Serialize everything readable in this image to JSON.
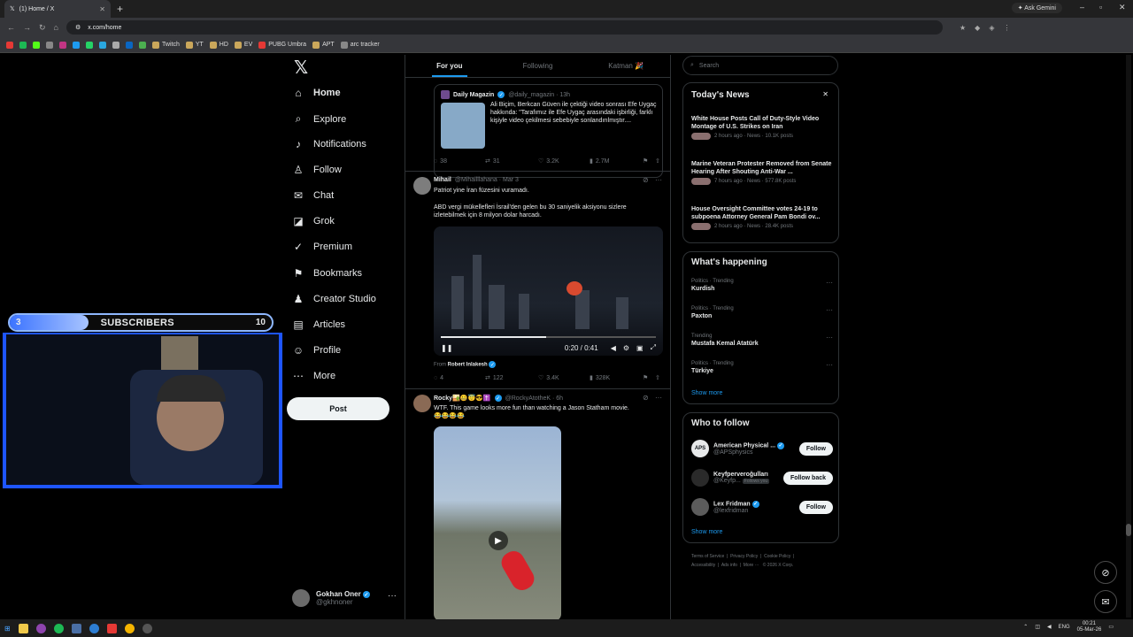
{
  "browser": {
    "tab_title": "(1) Home / X",
    "tab_close": "✕",
    "new_tab": "+",
    "gemini": "Ask Gemini",
    "url": "x.com/home",
    "bookmarks": [
      {
        "label": "Twitch",
        "color": "#caa75b"
      },
      {
        "label": "YT",
        "color": "#caa75b"
      },
      {
        "label": "HD",
        "color": "#caa75b"
      },
      {
        "label": "EV",
        "color": "#caa75b"
      },
      {
        "label": "PUBG Umbra",
        "color": "#e53935"
      },
      {
        "label": "APT",
        "color": "#caa75b"
      },
      {
        "label": "arc tracker",
        "color": "#888888"
      }
    ]
  },
  "nav": {
    "logo": "𝕏",
    "items": [
      {
        "label": "Home",
        "icon": "⌂"
      },
      {
        "label": "Explore",
        "icon": "⌕"
      },
      {
        "label": "Notifications",
        "icon": "♪"
      },
      {
        "label": "Follow",
        "icon": "♙"
      },
      {
        "label": "Chat",
        "icon": "✉"
      },
      {
        "label": "Grok",
        "icon": "◪"
      },
      {
        "label": "Premium",
        "icon": "✓"
      },
      {
        "label": "Bookmarks",
        "icon": "⚑"
      },
      {
        "label": "Creator Studio",
        "icon": "♟"
      },
      {
        "label": "Articles",
        "icon": "▤"
      },
      {
        "label": "Profile",
        "icon": "☺"
      },
      {
        "label": "More",
        "icon": "⋯"
      }
    ],
    "post_label": "Post",
    "account": {
      "name": "Gokhan Oner",
      "handle": "@gkhnoner",
      "more": "···"
    }
  },
  "overlay": {
    "current": "3",
    "title": "SUBSCRIBERS",
    "goal": "10",
    "progress": 0.3
  },
  "feed": {
    "tabs": [
      "For you",
      "Following",
      "Katman 🎉"
    ],
    "quote": {
      "name": "Daily Magazin",
      "meta": "@daily_magazin · 13h",
      "text": "Ali Biçim, Berkcan Güven ile çektiği video sonrası Efe Uygaç hakkında: \"Tarafımız ile Efe Uygaç arasındaki işbirliği, farklı kişiyle video çekilmesi sebebiyle sonlandırılmıştır...."
    },
    "actions1": {
      "replies": "38",
      "reposts": "31",
      "likes": "3.2K",
      "views": "2.7M"
    },
    "tweet2": {
      "name": "Mihail",
      "meta": "@Mihailllahana · Mar 3",
      "line1": "Patriot yine İran füzesini vuramadı.",
      "line2": "ABD vergi mükellefleri İsrail'den gelen bu 30 saniyelik aksiyonu sizlere izletebilmek için 8 milyon dolar harcadı.",
      "video_time": "0:20 / 0:41",
      "video_progress": 0.49,
      "from_label": "From",
      "from_name": "Robert Inlakesh"
    },
    "actions2": {
      "replies": "4",
      "reposts": "122",
      "likes": "3.4K",
      "views": "328K"
    },
    "tweet3": {
      "name": "Rocky🏜️🤐😇😎✝️",
      "meta": "@RockyAtotheK · 6h",
      "text": "WTF. This game looks more fun than watching a Jason Statham movie.",
      "emoji": "😂😂😂😂"
    }
  },
  "right": {
    "search_placeholder": "Search",
    "news_title": "Today's News",
    "news_close": "✕",
    "news": [
      {
        "headline": "White House Posts Call of Duty-Style Video Montage of U.S. Strikes on Iran",
        "meta": "2 hours ago · News · 10.1K posts"
      },
      {
        "headline": "Marine Veteran Protester Removed from Senate Hearing After Shouting Anti-War ...",
        "meta": "7 hours ago · News · 577.8K posts"
      },
      {
        "headline": "House Oversight Committee votes 24-19 to subpoena Attorney General Pam Bondi ov...",
        "meta": "2 hours ago · News · 28.4K posts"
      }
    ],
    "happening_title": "What's happening",
    "trends": [
      {
        "context": "Politics · Trending",
        "topic": "Kurdish"
      },
      {
        "context": "Politics · Trending",
        "topic": "Paxton"
      },
      {
        "context": "Trending",
        "topic": "Mustafa Kemal Atatürk"
      },
      {
        "context": "Politics · Trending",
        "topic": "Türkiye"
      }
    ],
    "show_more": "Show more",
    "wtf_title": "Who to follow",
    "follow": [
      {
        "name": "American Physical ...",
        "handle": "@APSphysics",
        "button": "Follow",
        "avatar": "APS"
      },
      {
        "name": "Keyfperveroğulları",
        "handle": "@Keyfp...",
        "badge": "Follows you",
        "button": "Follow back",
        "avatar": ""
      },
      {
        "name": "Lex Fridman",
        "handle": "@lexfridman",
        "button": "Follow",
        "avatar": ""
      }
    ],
    "footer": [
      "Terms of Service",
      "Privacy Policy",
      "Cookie Policy",
      "Accessibility",
      "Ads info",
      "More ···",
      "© 2026 X Corp."
    ]
  },
  "taskbar": {
    "lang": "ENG",
    "time": "00:21",
    "date": "05-Mar-26"
  }
}
